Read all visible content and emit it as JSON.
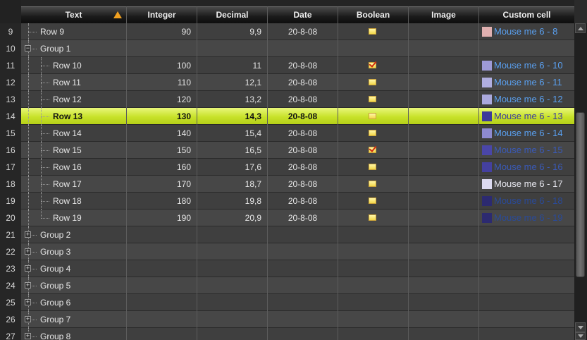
{
  "columns": {
    "text": "Text",
    "integer": "Integer",
    "decimal": "Decimal",
    "date": "Date",
    "boolean": "Boolean",
    "image": "Image",
    "custom": "Custom cell"
  },
  "sort_indicator": "sort-ascending-icon",
  "colors": {
    "selected_row": "#c8e22a",
    "link_text": "#4a90e8",
    "sort_arrow": "#f0a020"
  },
  "rows": [
    {
      "num": "9",
      "kind": "child",
      "text": "Row 9",
      "integer": "90",
      "decimal": "9,9",
      "date": "20-8-08",
      "bool": false,
      "custom": "Mouse me 6 - 8",
      "swatch": "#e0b0b0",
      "custom_color": "#5aa0f0"
    },
    {
      "num": "10",
      "kind": "group",
      "expanded": true,
      "text": "Group 1"
    },
    {
      "num": "11",
      "kind": "child",
      "text": "Row 10",
      "integer": "100",
      "decimal": "11",
      "date": "20-8-08",
      "bool": true,
      "custom": "Mouse me 6 - 10",
      "swatch": "#9e9ad6",
      "custom_color": "#5aa0f0"
    },
    {
      "num": "12",
      "kind": "child",
      "text": "Row 11",
      "integer": "110",
      "decimal": "12,1",
      "date": "20-8-08",
      "bool": false,
      "custom": "Mouse me 6 - 11",
      "swatch": "#b0aee0",
      "custom_color": "#5aa0f0"
    },
    {
      "num": "13",
      "kind": "child",
      "text": "Row 12",
      "integer": "120",
      "decimal": "13,2",
      "date": "20-8-08",
      "bool": false,
      "custom": "Mouse me 6 - 12",
      "swatch": "#aaa8dc",
      "custom_color": "#5aa0f0"
    },
    {
      "num": "14",
      "kind": "child",
      "selected": true,
      "text": "Row 13",
      "integer": "130",
      "decimal": "14,3",
      "date": "20-8-08",
      "bool": false,
      "custom": "Mouse me 6 - 13",
      "swatch": "#3e3a9a",
      "custom_color": "#3a3aa0"
    },
    {
      "num": "15",
      "kind": "child",
      "text": "Row 14",
      "integer": "140",
      "decimal": "15,4",
      "date": "20-8-08",
      "bool": false,
      "custom": "Mouse me 6 - 14",
      "swatch": "#8e8ad0",
      "custom_color": "#5aa0f0"
    },
    {
      "num": "16",
      "kind": "child",
      "text": "Row 15",
      "integer": "150",
      "decimal": "16,5",
      "date": "20-8-08",
      "bool": true,
      "custom": "Mouse me 6 - 15",
      "swatch": "#4a46a8",
      "custom_color": "#3a5ab8"
    },
    {
      "num": "17",
      "kind": "child",
      "text": "Row 16",
      "integer": "160",
      "decimal": "17,6",
      "date": "20-8-08",
      "bool": false,
      "custom": "Mouse me 6 - 16",
      "swatch": "#4440a0",
      "custom_color": "#3a5ab8"
    },
    {
      "num": "18",
      "kind": "child",
      "text": "Row 17",
      "integer": "170",
      "decimal": "18,7",
      "date": "20-8-08",
      "bool": false,
      "custom": "Mouse me 6 - 17",
      "swatch": "#dcdaf0",
      "custom_color": "#e8e8f0"
    },
    {
      "num": "19",
      "kind": "child",
      "text": "Row 18",
      "integer": "180",
      "decimal": "19,8",
      "date": "20-8-08",
      "bool": false,
      "custom": "Mouse me 6 - 18",
      "swatch": "#2c2a70",
      "custom_color": "#2a4a98"
    },
    {
      "num": "20",
      "kind": "child",
      "last": true,
      "text": "Row 19",
      "integer": "190",
      "decimal": "20,9",
      "date": "20-8-08",
      "bool": false,
      "custom": "Mouse me 6 - 19",
      "swatch": "#2c2a70",
      "custom_color": "#2a4a98"
    },
    {
      "num": "21",
      "kind": "group",
      "expanded": false,
      "text": "Group 2"
    },
    {
      "num": "22",
      "kind": "group",
      "expanded": false,
      "text": "Group 3"
    },
    {
      "num": "23",
      "kind": "group",
      "expanded": false,
      "text": "Group 4"
    },
    {
      "num": "24",
      "kind": "group",
      "expanded": false,
      "text": "Group 5"
    },
    {
      "num": "25",
      "kind": "group",
      "expanded": false,
      "text": "Group 6"
    },
    {
      "num": "26",
      "kind": "group",
      "expanded": false,
      "text": "Group 7"
    },
    {
      "num": "27",
      "kind": "group",
      "expanded": false,
      "text": "Group 8"
    }
  ]
}
